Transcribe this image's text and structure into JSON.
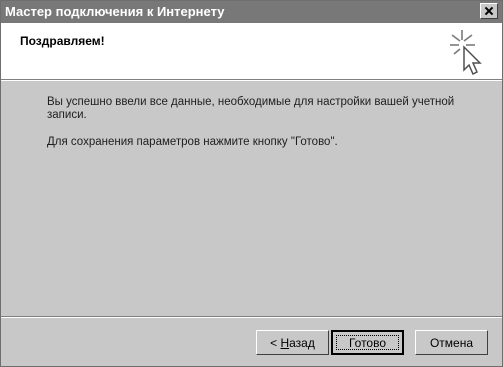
{
  "window": {
    "title": "Мастер подключения к Интернету"
  },
  "header": {
    "title": "Поздравляем!",
    "icon": "wizard-sparkle-cursor-icon"
  },
  "content": {
    "line1": "Вы успешно ввели все данные, необходимые для настройки вашей учетной записи.",
    "line2": "Для сохранения параметров нажмите кнопку \"Готово\"."
  },
  "buttons": {
    "back_prefix": "< ",
    "back_accel": "Н",
    "back_rest": "азад",
    "finish": "Готово",
    "cancel": "Отмена"
  }
}
